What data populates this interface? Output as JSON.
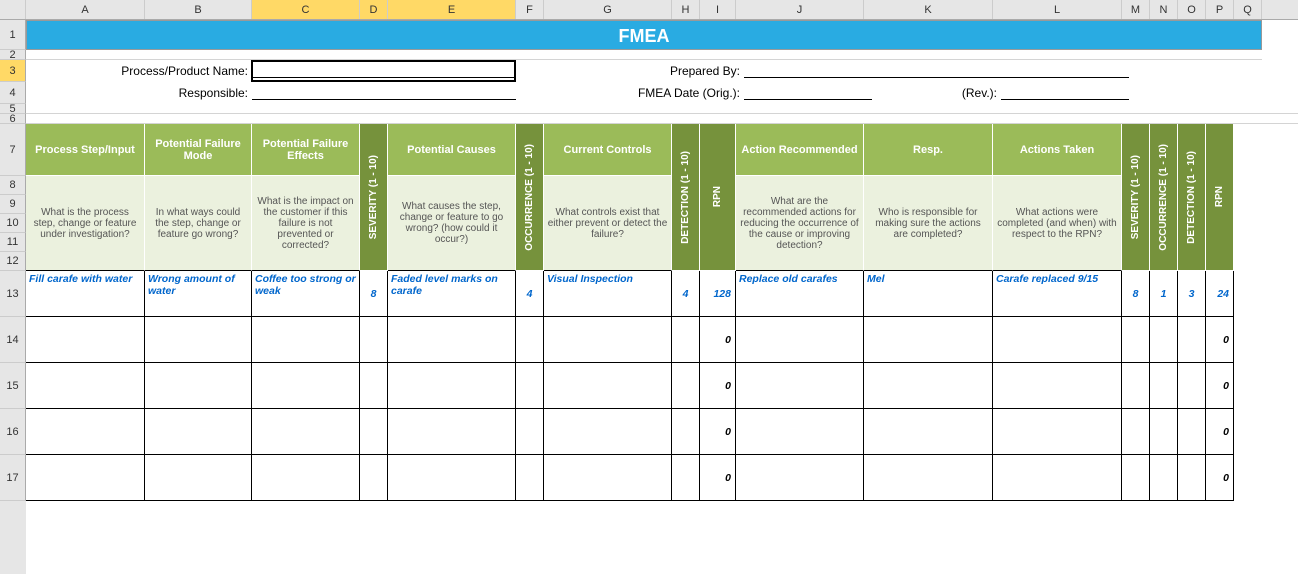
{
  "cols": [
    "A",
    "B",
    "C",
    "D",
    "E",
    "F",
    "G",
    "H",
    "I",
    "J",
    "K",
    "L",
    "M",
    "N",
    "O",
    "P",
    "Q"
  ],
  "selectedCols": [
    "C",
    "D",
    "E"
  ],
  "rows": [
    1,
    2,
    3,
    4,
    5,
    6,
    7,
    8,
    9,
    10,
    11,
    12,
    13,
    14,
    15,
    16,
    17
  ],
  "selectedRow": 3,
  "title": "FMEA",
  "form": {
    "processName": "Process/Product Name:",
    "responsible": "Responsible:",
    "preparedBy": "Prepared By:",
    "fmeaDate": "FMEA Date (Orig.):",
    "rev": "(Rev.):"
  },
  "headers": {
    "processStep": "Process Step/Input",
    "failureMode": "Potential Failure Mode",
    "failureEffects": "Potential Failure Effects",
    "severity": "SEVERITY  (1 - 10)",
    "causes": "Potential Causes",
    "occurrence": "OCCURRENCE  (1 - 10)",
    "controls": "Current Controls",
    "detection": "DETECTION  (1 - 10)",
    "rpn": "RPN",
    "action": "Action Recommended",
    "resp": "Resp.",
    "taken": "Actions Taken",
    "severity2": "SEVERITY  (1 - 10)",
    "occurrence2": "OCCURRENCE  (1 - 10)",
    "detection2": "DETECTION  (1 - 10)",
    "rpn2": "RPN"
  },
  "desc": {
    "processStep": "What is the process step, change or feature under investigation?",
    "failureMode": "In what ways could the step, change or feature go wrong?",
    "failureEffects": "What is the impact on the customer if this failure is not prevented or corrected?",
    "causes": "What causes the step, change or feature to go wrong? (how could it occur?)",
    "controls": "What controls exist that either prevent or detect the failure?",
    "action": "What are the recommended actions for reducing the occurrence of the cause or improving detection?",
    "resp": "Who is responsible for making sure the actions are completed?",
    "taken": "What actions were completed (and when) with respect to the RPN?"
  },
  "data": [
    {
      "processStep": "Fill carafe with water",
      "failureMode": "Wrong amount of water",
      "failureEffects": "Coffee too strong or weak",
      "severity": "8",
      "causes": "Faded level marks on carafe",
      "occurrence": "4",
      "controls": "Visual Inspection",
      "detection": "4",
      "rpn": "128",
      "action": "Replace old carafes",
      "resp": "Mel",
      "taken": "Carafe replaced 9/15",
      "severity2": "8",
      "occurrence2": "1",
      "detection2": "3",
      "rpn2": "24"
    },
    {
      "rpn": "0",
      "rpn2": "0"
    },
    {
      "rpn": "0",
      "rpn2": "0"
    },
    {
      "rpn": "0",
      "rpn2": "0"
    },
    {
      "rpn": "0",
      "rpn2": "0"
    }
  ]
}
